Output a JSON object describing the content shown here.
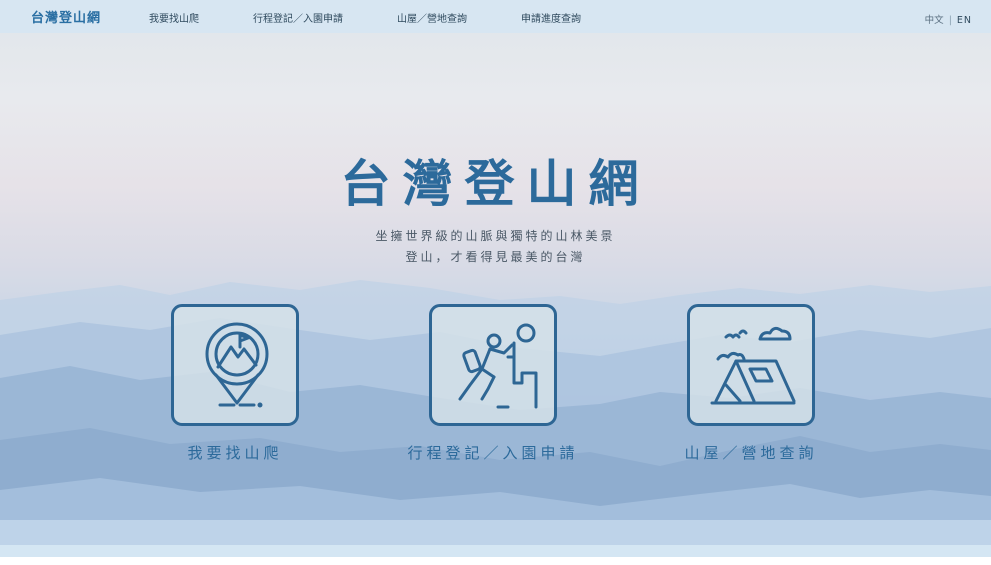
{
  "header": {
    "logo": "台灣登山網",
    "nav": [
      {
        "label": "我要找山爬"
      },
      {
        "label": "行程登記／入園申請"
      },
      {
        "label": "山屋／營地查詢"
      },
      {
        "label": "申請進度查詢"
      }
    ],
    "lang": {
      "zh": "中文",
      "sep": "|",
      "en": "EN"
    }
  },
  "hero": {
    "title": "台灣登山網",
    "subtitle_line1": "坐擁世界級的山脈與獨特的山林美景",
    "subtitle_line2": "登山，才看得見最美的台灣"
  },
  "cards": [
    {
      "label": "我要找山爬",
      "icon": "map-pin-mountain-icon"
    },
    {
      "label": "行程登記／入園申請",
      "icon": "hiker-climbing-icon"
    },
    {
      "label": "山屋／營地查詢",
      "icon": "tent-icon"
    }
  ],
  "colors": {
    "brand": "#2c6a9b",
    "icon_stroke": "#2e6694",
    "topbar": "#d6e6f2"
  }
}
